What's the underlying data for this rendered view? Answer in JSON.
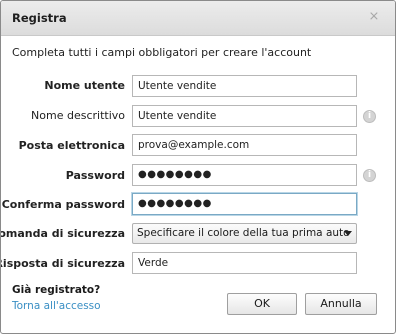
{
  "dialog": {
    "title": "Registra",
    "close_symbol": "⨯",
    "subtitle": "Completa tutti i campi obbligatori per creare l'account"
  },
  "form": {
    "username": {
      "label": "Nome utente",
      "value": "Utente vendite"
    },
    "display_name": {
      "label": "Nome descrittivo",
      "value": "Utente vendite",
      "info_icon": "info-icon"
    },
    "email": {
      "label": "Posta elettronica",
      "value": "prova@example.com"
    },
    "password": {
      "label": "Password",
      "value": "●●●●●●●●",
      "info_icon": "info-icon"
    },
    "confirm_password": {
      "label": "Conferma password",
      "value": "●●●●●●●●"
    },
    "security_question": {
      "label": "Domanda di sicurezza",
      "value": "Specificare il colore della tua prima auto"
    },
    "security_answer": {
      "label": "Risposta di sicurezza",
      "value": "Verde"
    }
  },
  "footer": {
    "registered_text": "Già registrato?",
    "back_link": "Torna all'accesso",
    "ok_label": "OK",
    "cancel_label": "Annulla"
  },
  "colors": {
    "link": "#3a8fc4",
    "focus_border": "#7aa9c5"
  }
}
